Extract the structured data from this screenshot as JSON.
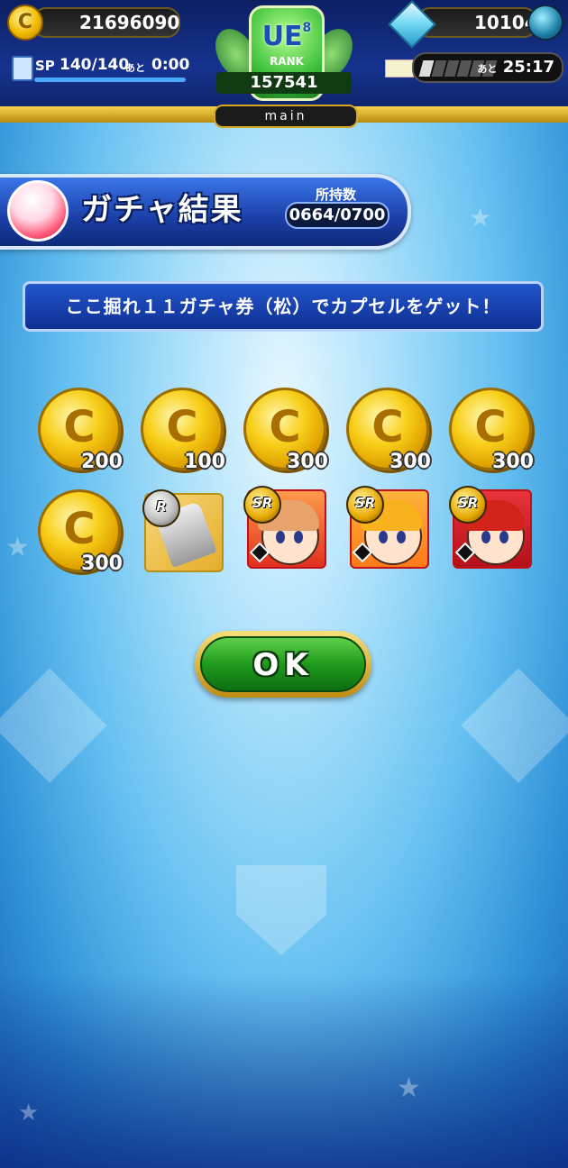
{
  "status_bar": {
    "coins": "21696090",
    "gems": "10104",
    "sp_label": "SP",
    "sp_value": "140/140",
    "sp_ato": "あと",
    "sp_timer": "0:00",
    "stamina_ato": "あと",
    "stamina_timer": "25:17",
    "stamina_segments_filled": 1,
    "stamina_segments_total": 6
  },
  "rank": {
    "grade": "UE",
    "sub": "8",
    "label": "RANK",
    "value": "157541"
  },
  "main_tab": "main",
  "result": {
    "title": "ガチャ結果",
    "owned_label": "所持数",
    "owned_value": "0664/0700"
  },
  "message": "ここ掘れ１１ガチャ券（松）でカプセルをゲット！",
  "coin_symbol": "C",
  "rewards": [
    {
      "type": "coin",
      "amount": "200"
    },
    {
      "type": "coin",
      "amount": "100"
    },
    {
      "type": "coin",
      "amount": "300"
    },
    {
      "type": "coin",
      "amount": "300"
    },
    {
      "type": "coin",
      "amount": "300"
    },
    {
      "type": "coin",
      "amount": "300"
    },
    {
      "type": "item",
      "rarity": "R"
    },
    {
      "type": "character",
      "rarity": "SR"
    },
    {
      "type": "character",
      "rarity": "SR"
    },
    {
      "type": "character",
      "rarity": "SR"
    }
  ],
  "ok_button": "OK",
  "colors": {
    "accent_gold": "#d4a921",
    "button_green": "#1f9a1c",
    "header_blue": "#1b3fa8"
  }
}
